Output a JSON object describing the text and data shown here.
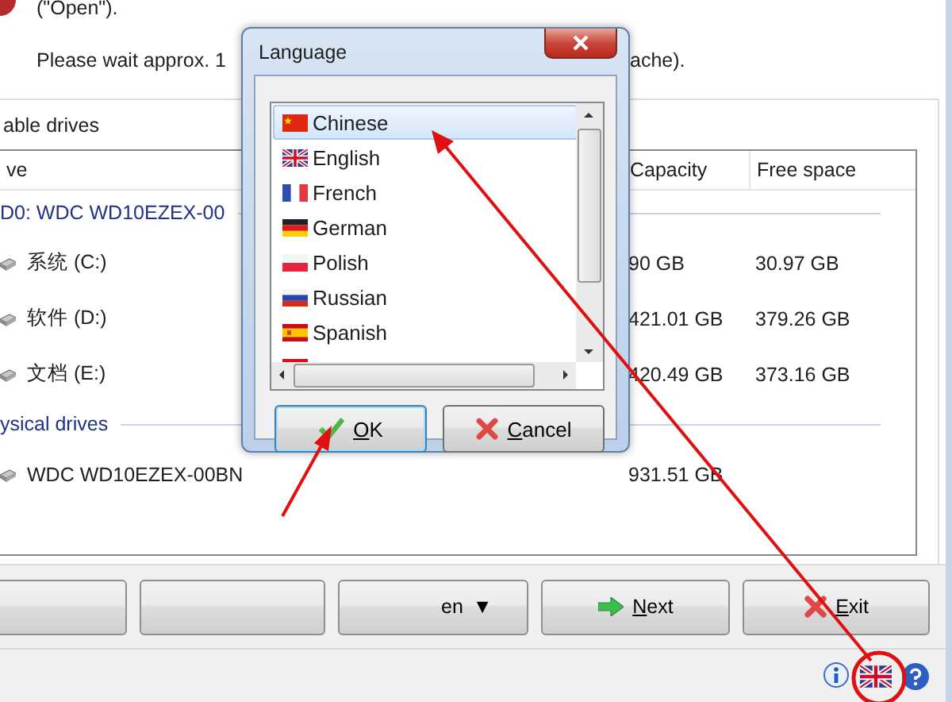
{
  "window": {
    "intro": {
      "line_1": "(\"Open\").",
      "line_2": "Please wait approx. 1",
      "line_2_tail": "ache)."
    },
    "drives_group": {
      "title": "able drives",
      "table": {
        "columns": [
          "ve",
          "Capacity",
          "Free space"
        ],
        "groups": [
          {
            "title": "D0: WDC  WD10EZEX-00",
            "rows": [
              {
                "name": "系统 (C:)",
                "capacity": "90 GB",
                "free_space": "30.97 GB"
              },
              {
                "name": "软件 (D:)",
                "capacity": "421.01 GB",
                "free_space": "379.26 GB"
              },
              {
                "name": "文档 (E:)",
                "capacity": "420.49 GB",
                "free_space": "373.16 GB"
              }
            ]
          },
          {
            "title": "ysical drives",
            "rows": [
              {
                "name": "WDC  WD10EZEX-00BN",
                "capacity": "931.51 GB"
              }
            ]
          }
        ]
      }
    },
    "buttons": [
      {
        "kind": "blank"
      },
      {
        "kind": "blank"
      },
      {
        "kind": "dropdown",
        "label": "en",
        "caret": "▼"
      },
      {
        "kind": "next",
        "label": "Next"
      },
      {
        "kind": "exit",
        "label": "Exit"
      }
    ]
  },
  "language_dialog": {
    "title": "Language",
    "languages": [
      {
        "label": "Chinese",
        "kind": "cn",
        "selected": true
      },
      {
        "label": "English",
        "kind": "gb",
        "selected": false
      },
      {
        "label": "French",
        "kind": "fr",
        "selected": false
      },
      {
        "label": "German",
        "kind": "de",
        "selected": false
      },
      {
        "label": "Polish",
        "kind": "pl",
        "selected": false
      },
      {
        "label": "Russian",
        "kind": "ru",
        "selected": false
      },
      {
        "label": "Spanish",
        "kind": "es",
        "selected": false
      },
      {
        "kind": "tr",
        "selected": false
      }
    ],
    "buttons": [
      {
        "kind": "ok",
        "label": "OK"
      },
      {
        "kind": "cancel",
        "label": "Cancel"
      }
    ]
  }
}
